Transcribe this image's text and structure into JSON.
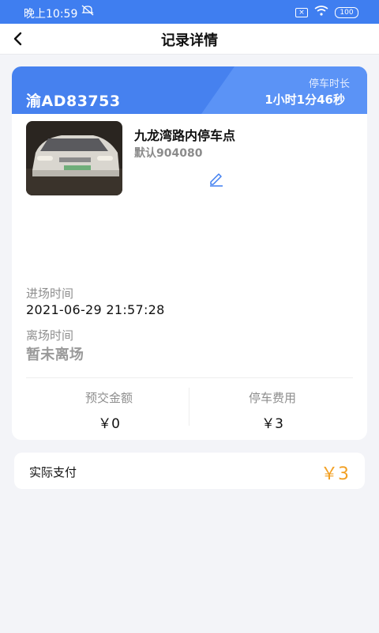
{
  "status_bar": {
    "time": "晚上10:59",
    "battery": "100"
  },
  "nav": {
    "title": "记录详情"
  },
  "record": {
    "plate": "渝AD83753",
    "duration_label": "停车时长",
    "duration": "1小时1分46秒",
    "lot_name": "九龙湾路内停车点",
    "lot_code": "默认904080",
    "entry_label": "进场时间",
    "entry_time": "2021-06-29 21:57:28",
    "exit_label": "离场时间",
    "exit_status": "暂未离场",
    "prepaid_label": "预交金额",
    "prepaid_value": "￥0",
    "fee_label": "停车费用",
    "fee_value": "￥3"
  },
  "payment": {
    "label": "实际支付",
    "value": "￥3"
  },
  "colors": {
    "primary": "#3f7ef0",
    "accent_orange": "#f2a024"
  },
  "icons": [
    "back-arrow-icon",
    "mute-icon",
    "wifi-icon",
    "battery-icon",
    "edit-pencil-icon"
  ]
}
